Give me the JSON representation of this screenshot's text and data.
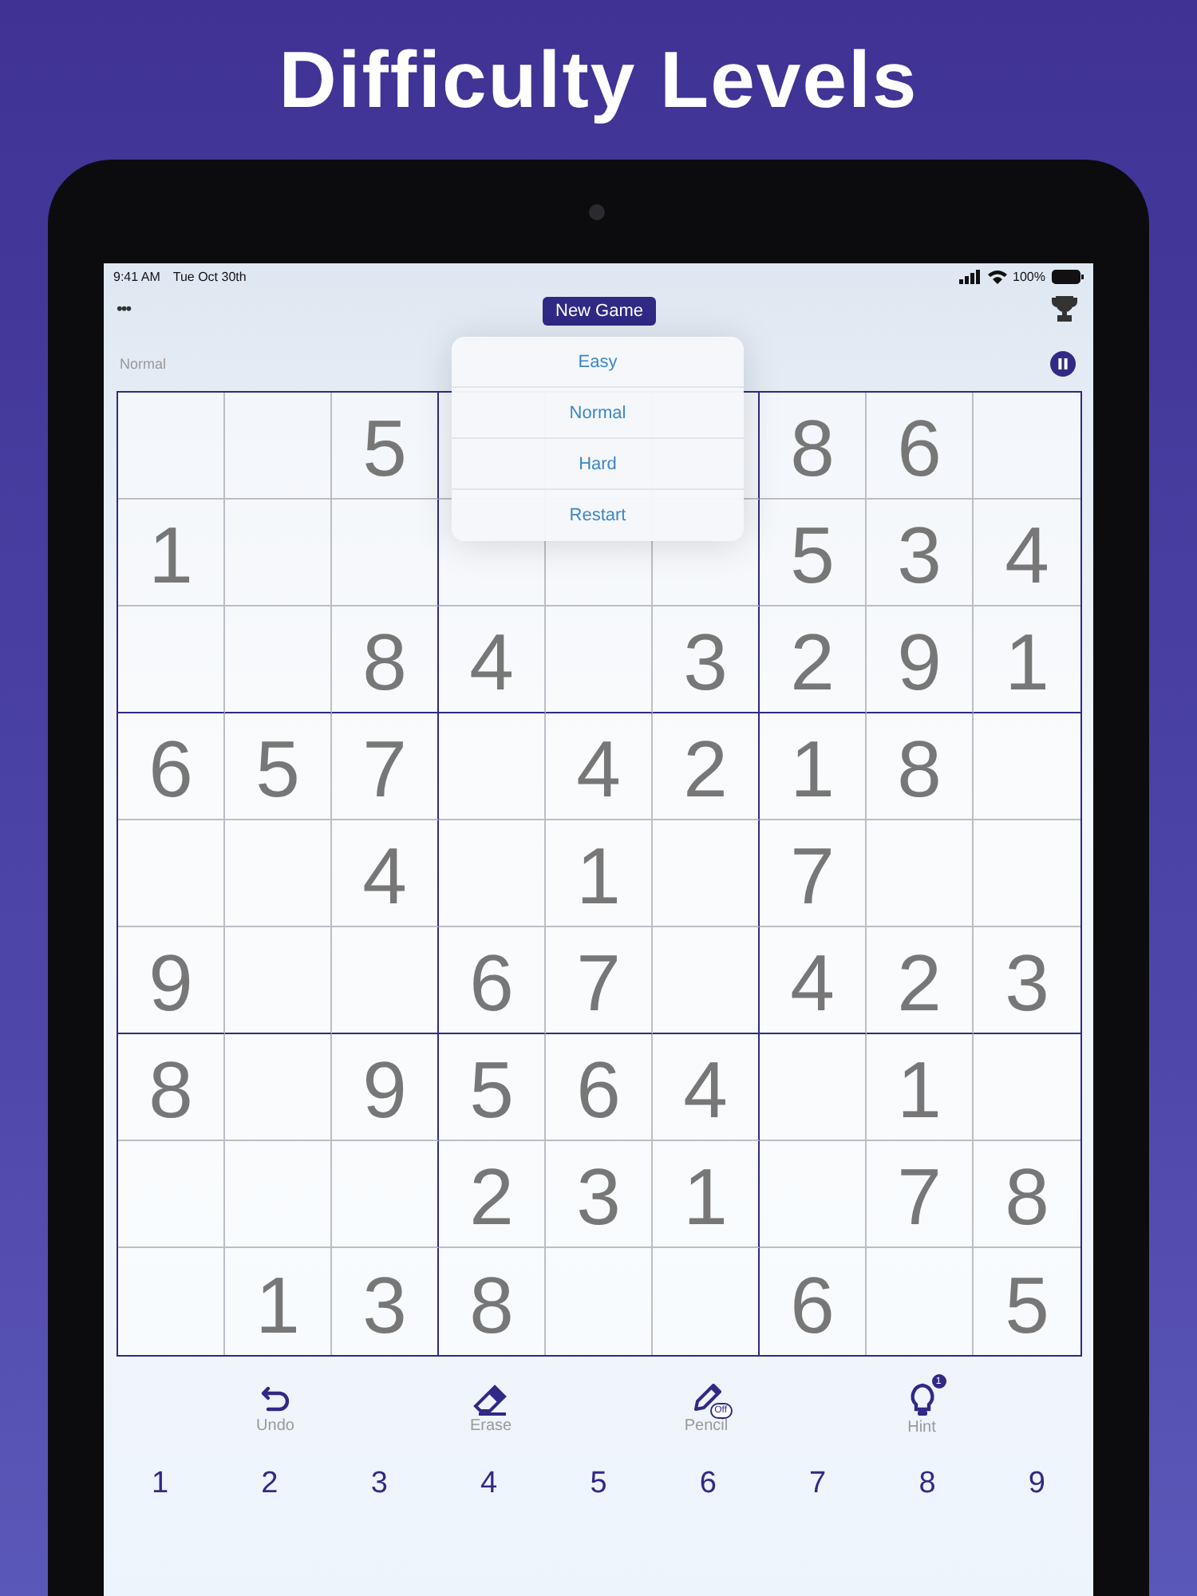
{
  "headline": "Difficulty Levels",
  "status_bar": {
    "time": "9:41 AM",
    "date": "Tue Oct 30th",
    "battery": "100%"
  },
  "nav": {
    "more": "•••",
    "new_game": "New Game"
  },
  "difficulty": "Normal",
  "menu": {
    "items": [
      {
        "label": "Easy"
      },
      {
        "label": "Normal"
      },
      {
        "label": "Hard"
      },
      {
        "label": "Restart"
      }
    ]
  },
  "grid": {
    "rows": [
      [
        null,
        null,
        "5",
        null,
        null,
        null,
        "8",
        "6",
        null
      ],
      [
        "1",
        null,
        null,
        null,
        null,
        null,
        "5",
        "3",
        "4"
      ],
      [
        null,
        null,
        "8",
        "4",
        null,
        "3",
        "2",
        "9",
        "1"
      ],
      [
        "6",
        "5",
        "7",
        null,
        "4",
        "2",
        "1",
        "8",
        null
      ],
      [
        null,
        null,
        "4",
        null,
        "1",
        null,
        "7",
        null,
        null
      ],
      [
        "9",
        null,
        null,
        "6",
        "7",
        null,
        "4",
        "2",
        "3"
      ],
      [
        "8",
        null,
        "9",
        "5",
        "6",
        "4",
        null,
        "1",
        null
      ],
      [
        null,
        null,
        null,
        "2",
        "3",
        "1",
        null,
        "7",
        "8"
      ],
      [
        null,
        "1",
        "3",
        "8",
        null,
        null,
        "6",
        null,
        "5"
      ]
    ]
  },
  "actions": [
    {
      "kind": "undo",
      "label": "Undo"
    },
    {
      "kind": "erase",
      "label": "Erase"
    },
    {
      "kind": "pencil",
      "label": "Pencil",
      "badge": "Off"
    },
    {
      "kind": "hint",
      "label": "Hint",
      "badge": "1"
    }
  ],
  "numbers": [
    "1",
    "2",
    "3",
    "4",
    "5",
    "6",
    "7",
    "8",
    "9"
  ]
}
